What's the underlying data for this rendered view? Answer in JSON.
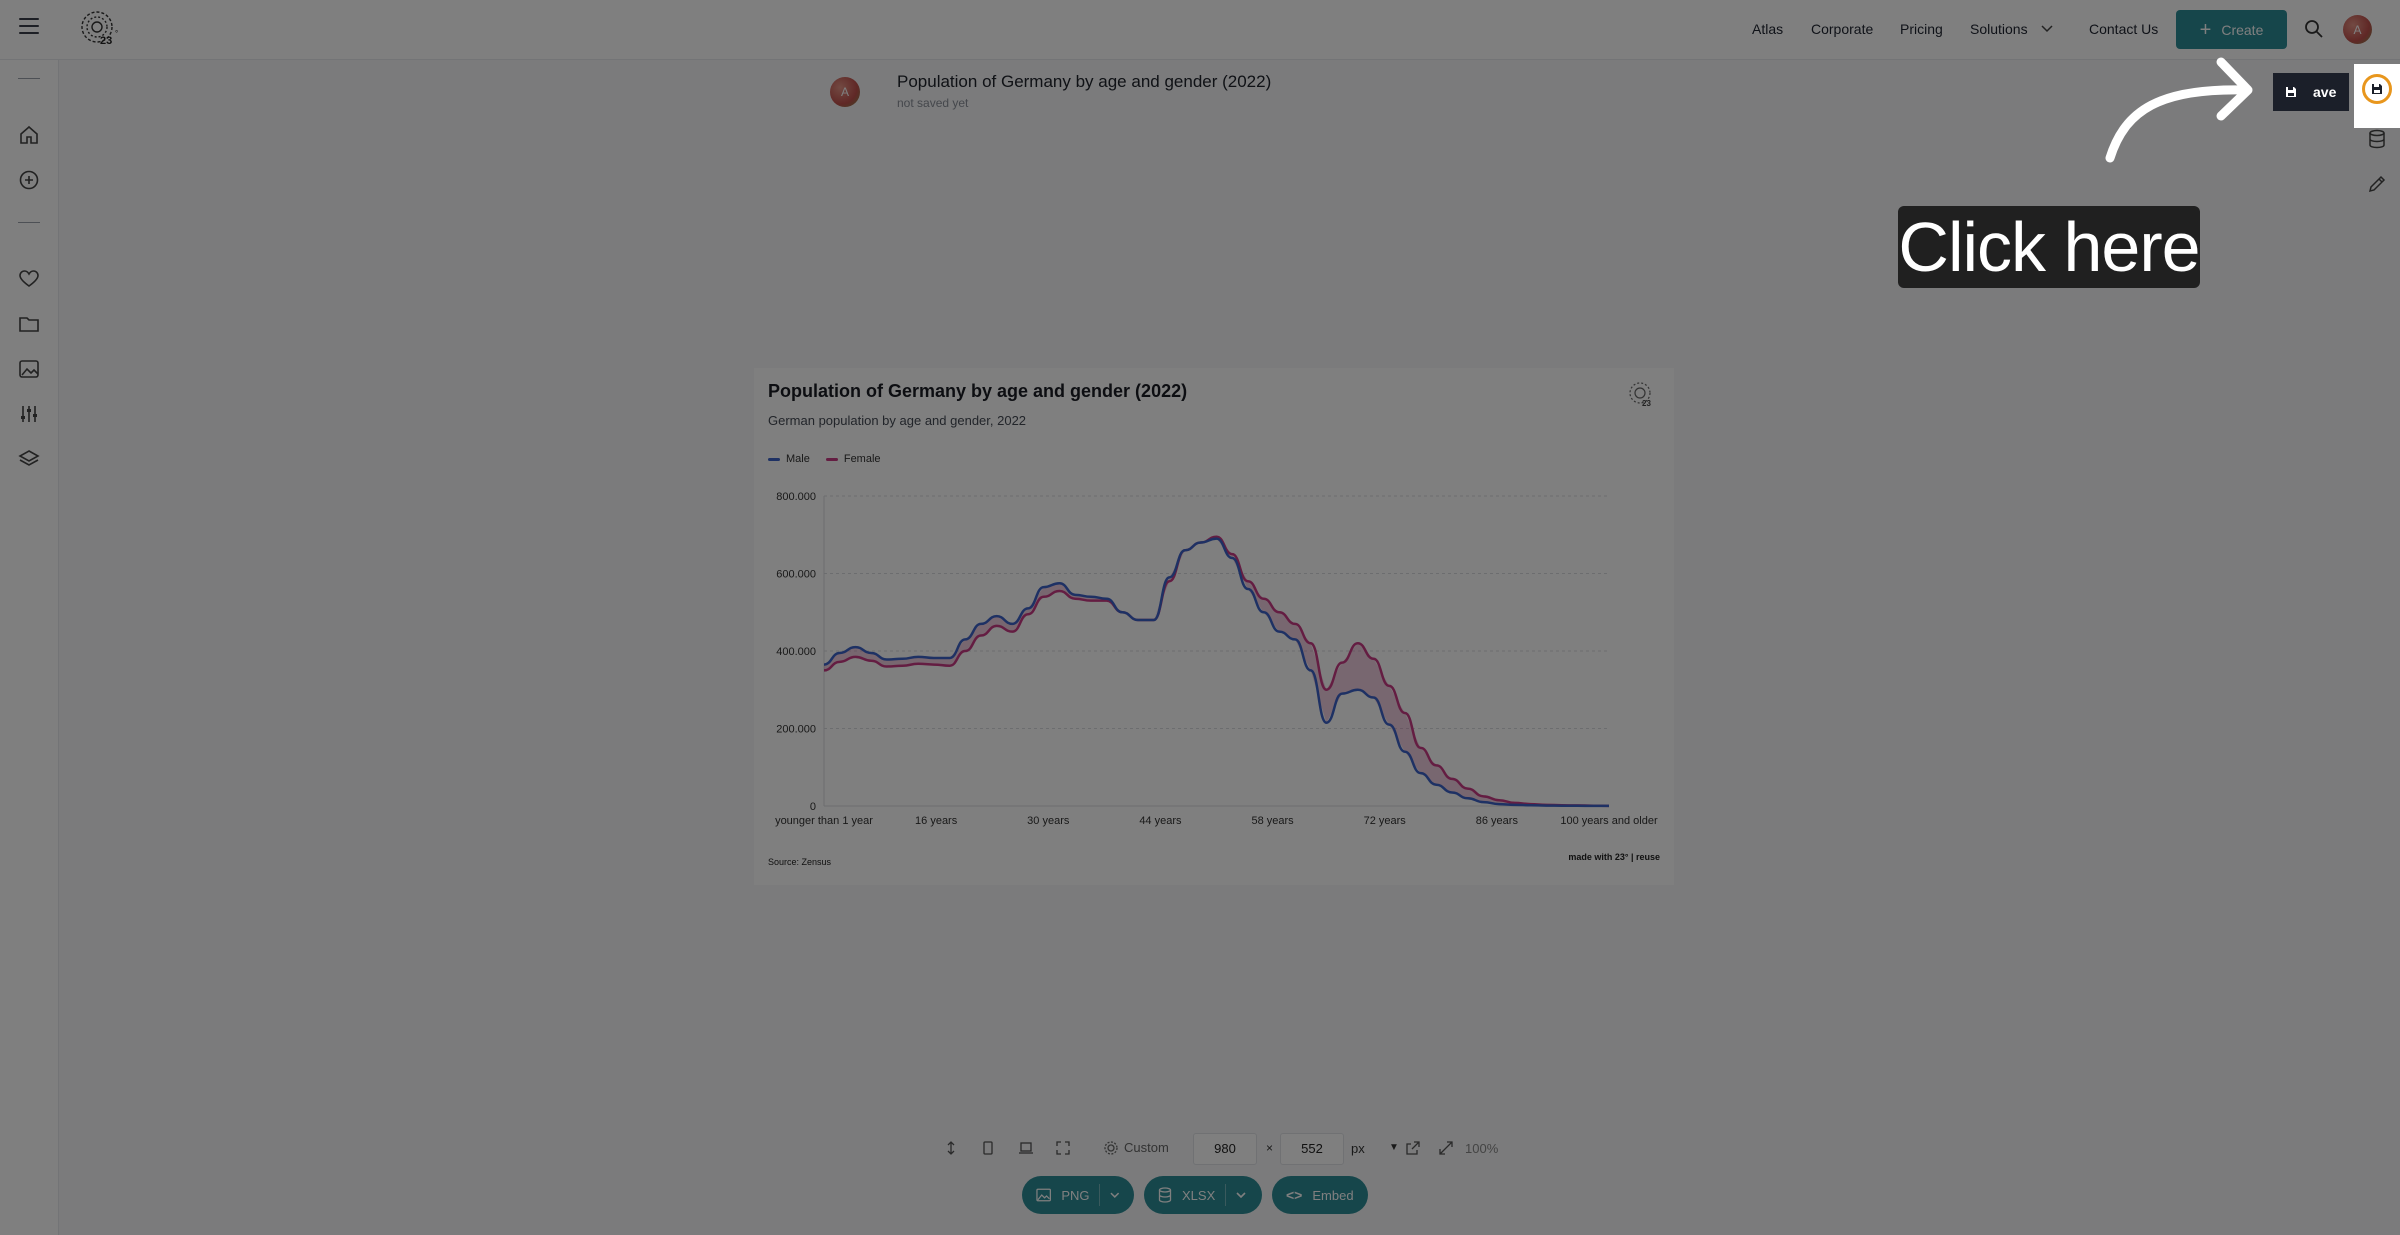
{
  "nav": {
    "items": [
      "Atlas",
      "Corporate",
      "Pricing",
      "Solutions",
      "Contact Us"
    ],
    "create_label": "Create",
    "user_initial": "A"
  },
  "document": {
    "title": "Population of Germany by age and gender (2022)",
    "status": "not saved yet",
    "avatar_initial": "A"
  },
  "chart_data": {
    "type": "area",
    "title": "Population of Germany by age and gender (2022)",
    "subtitle": "German population by age and gender, 2022",
    "xlabel": "",
    "ylabel": "",
    "x_tick_labels": [
      "younger than 1 year",
      "16 years",
      "30 years",
      "44 years",
      "58 years",
      "72 years",
      "86 years",
      "100 years and older"
    ],
    "y_tick_labels": [
      "0",
      "200.000",
      "400.000",
      "600.000",
      "800.000"
    ],
    "ylim": [
      0,
      800000
    ],
    "grid": true,
    "legend_position": "top-left",
    "x": [
      0,
      2,
      4,
      6,
      8,
      10,
      12,
      14,
      16,
      18,
      20,
      22,
      24,
      26,
      28,
      30,
      32,
      34,
      36,
      38,
      40,
      42,
      44,
      46,
      48,
      50,
      52,
      54,
      56,
      58,
      60,
      62,
      64,
      66,
      68,
      70,
      72,
      74,
      76,
      78,
      80,
      82,
      84,
      86,
      88,
      90,
      92,
      94,
      96,
      98,
      100
    ],
    "series": [
      {
        "name": "Male",
        "color": "#3c63c8",
        "values": [
          365000,
          395000,
          410000,
          395000,
          378000,
          380000,
          385000,
          382000,
          382000,
          430000,
          470000,
          490000,
          470000,
          510000,
          565000,
          575000,
          545000,
          540000,
          535000,
          500000,
          480000,
          480000,
          590000,
          660000,
          680000,
          690000,
          640000,
          560000,
          500000,
          450000,
          430000,
          350000,
          215000,
          290000,
          300000,
          280000,
          210000,
          140000,
          85000,
          55000,
          35000,
          20000,
          10000,
          5000,
          3000,
          2000,
          1000,
          800,
          600,
          300,
          200
        ]
      },
      {
        "name": "Female",
        "color": "#c93a84",
        "values": [
          350000,
          372000,
          385000,
          375000,
          360000,
          362000,
          367000,
          365000,
          362000,
          400000,
          440000,
          465000,
          450000,
          495000,
          540000,
          555000,
          535000,
          530000,
          530000,
          500000,
          480000,
          480000,
          580000,
          660000,
          680000,
          695000,
          650000,
          580000,
          535000,
          500000,
          470000,
          420000,
          300000,
          370000,
          420000,
          380000,
          310000,
          240000,
          150000,
          105000,
          70000,
          45000,
          25000,
          15000,
          8000,
          5000,
          3000,
          2000,
          1500,
          800,
          400
        ]
      }
    ],
    "source": "Source: Zensus",
    "credit": "made with 23° | reuse"
  },
  "export_bar": {
    "preset_label": "Custom",
    "width": "980",
    "height": "552",
    "times": "×",
    "unit": "px",
    "zoom": "100%",
    "png_label": "PNG",
    "xlsx_label": "XLSX",
    "embed_label": "Embed"
  },
  "save": {
    "label": "ave"
  },
  "tutorial": {
    "callout": "Click here"
  }
}
